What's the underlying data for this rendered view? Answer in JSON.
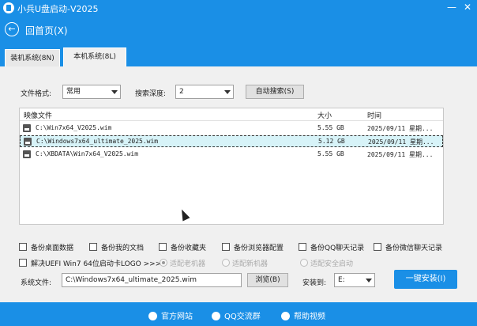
{
  "window": {
    "title": "小兵U盘启动-V2025",
    "min": "—",
    "close": "✕"
  },
  "nav": {
    "back_glyph": "←",
    "back_label": "回首页(X)"
  },
  "tabs": [
    {
      "label": "装机系统(8N)"
    },
    {
      "label": "本机系统(8L)"
    }
  ],
  "filters": {
    "format_label": "文件格式:",
    "format_value": "常用",
    "depth_label": "搜索深度:",
    "depth_value": "2",
    "auto_search": "自动搜索(S)"
  },
  "table": {
    "headers": {
      "file": "映像文件",
      "size": "大小",
      "time": "时间"
    },
    "rows": [
      {
        "file": "C:\\Win7x64_V2025.wim",
        "size": "5.55 GB",
        "time": "2025/09/11 星期..."
      },
      {
        "file": "C:\\Windows7x64_ultimate_2025.wim",
        "size": "5.12 GB",
        "time": "2025/09/11 星期..."
      },
      {
        "file": "C:\\XBDATA\\Win7x64_V2025.wim",
        "size": "5.55 GB",
        "time": "2025/09/11 星期..."
      }
    ]
  },
  "backup": [
    "备份桌面数据",
    "备份我的文档",
    "备份收藏夹",
    "备份浏览器配置",
    "备份QQ聊天记录",
    "备份微信聊天记录"
  ],
  "options": {
    "logo_fix": "解决UEFI Win7 64位启动卡LOGO >>>>",
    "radio1": "适配老机器",
    "radio2": "适配新机器",
    "radio3": "适配安全启动"
  },
  "bottom": {
    "sysfile_label": "系统文件:",
    "sysfile_value": "C:\\Windows7x64_ultimate_2025.wim",
    "browse": "浏览(B)",
    "install_to_label": "安装到:",
    "install_to_value": "E:",
    "install_button": "一键安装(I)"
  },
  "footer": {
    "site": "官方网站",
    "qq": "QQ交流群",
    "help": "帮助视频"
  }
}
